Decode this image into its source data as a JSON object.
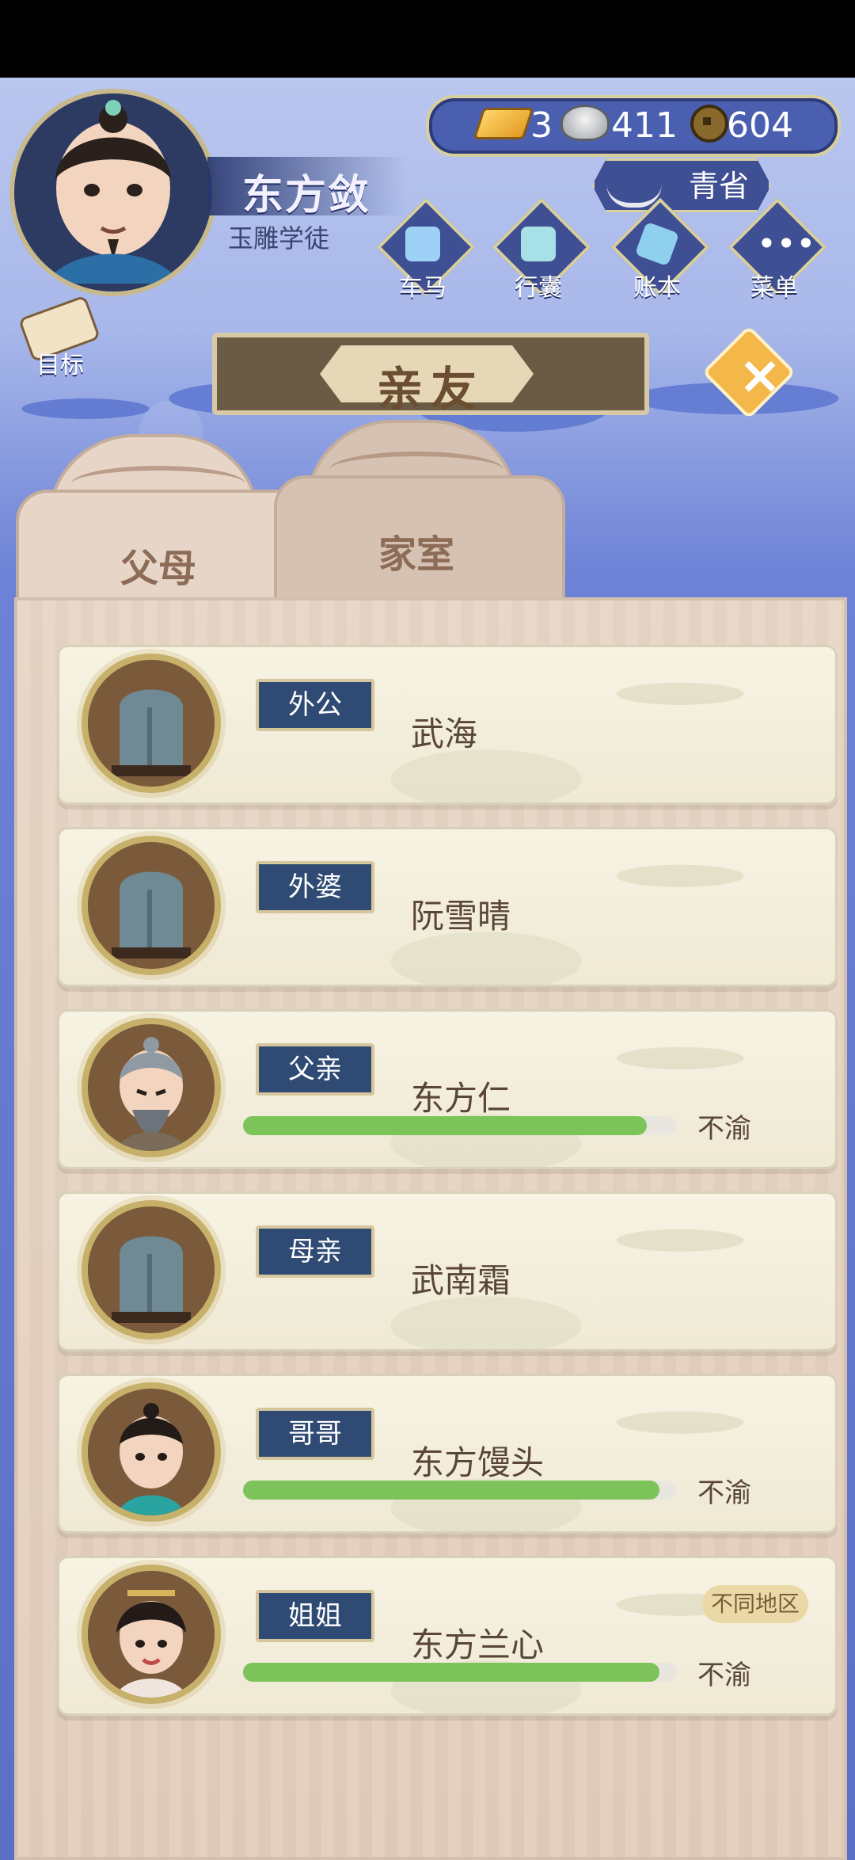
{
  "player": {
    "name": "东方敛",
    "title": "玉雕学徒"
  },
  "currency": {
    "gold": "3",
    "silver": "411",
    "coins": "604"
  },
  "region": {
    "label": "青省"
  },
  "top_menu": [
    {
      "label": "车马",
      "icon": "carriage-icon"
    },
    {
      "label": "行囊",
      "icon": "bag-icon"
    },
    {
      "label": "账本",
      "icon": "ledger-icon"
    },
    {
      "label": "菜单",
      "icon": "menu-dots-icon"
    }
  ],
  "goal": {
    "label": "目标"
  },
  "page": {
    "title": "亲友"
  },
  "tabs": [
    {
      "label": "父母",
      "active": true
    },
    {
      "label": "家室",
      "active": false
    }
  ],
  "family": [
    {
      "role": "外公",
      "name": "武海",
      "status": "",
      "mood": null,
      "region_tag": "",
      "portrait": "tombstone"
    },
    {
      "role": "外婆",
      "name": "阮雪晴",
      "status": "",
      "mood": null,
      "region_tag": "",
      "portrait": "tombstone"
    },
    {
      "role": "父亲",
      "name": "东方仁",
      "status": "不渝",
      "mood": 0.93,
      "region_tag": "",
      "portrait": "old-man"
    },
    {
      "role": "母亲",
      "name": "武南霜",
      "status": "",
      "mood": null,
      "region_tag": "",
      "portrait": "tombstone"
    },
    {
      "role": "哥哥",
      "name": "东方馒头",
      "status": "不渝",
      "mood": 0.96,
      "region_tag": "",
      "portrait": "young-man"
    },
    {
      "role": "姐姐",
      "name": "东方兰心",
      "status": "不渝",
      "mood": 0.96,
      "region_tag": "不同地区",
      "portrait": "woman"
    }
  ],
  "colors": {
    "accent": "#d8cf9e",
    "badge_bg": "#2f4a73",
    "mood_green": "#7cc45a"
  }
}
